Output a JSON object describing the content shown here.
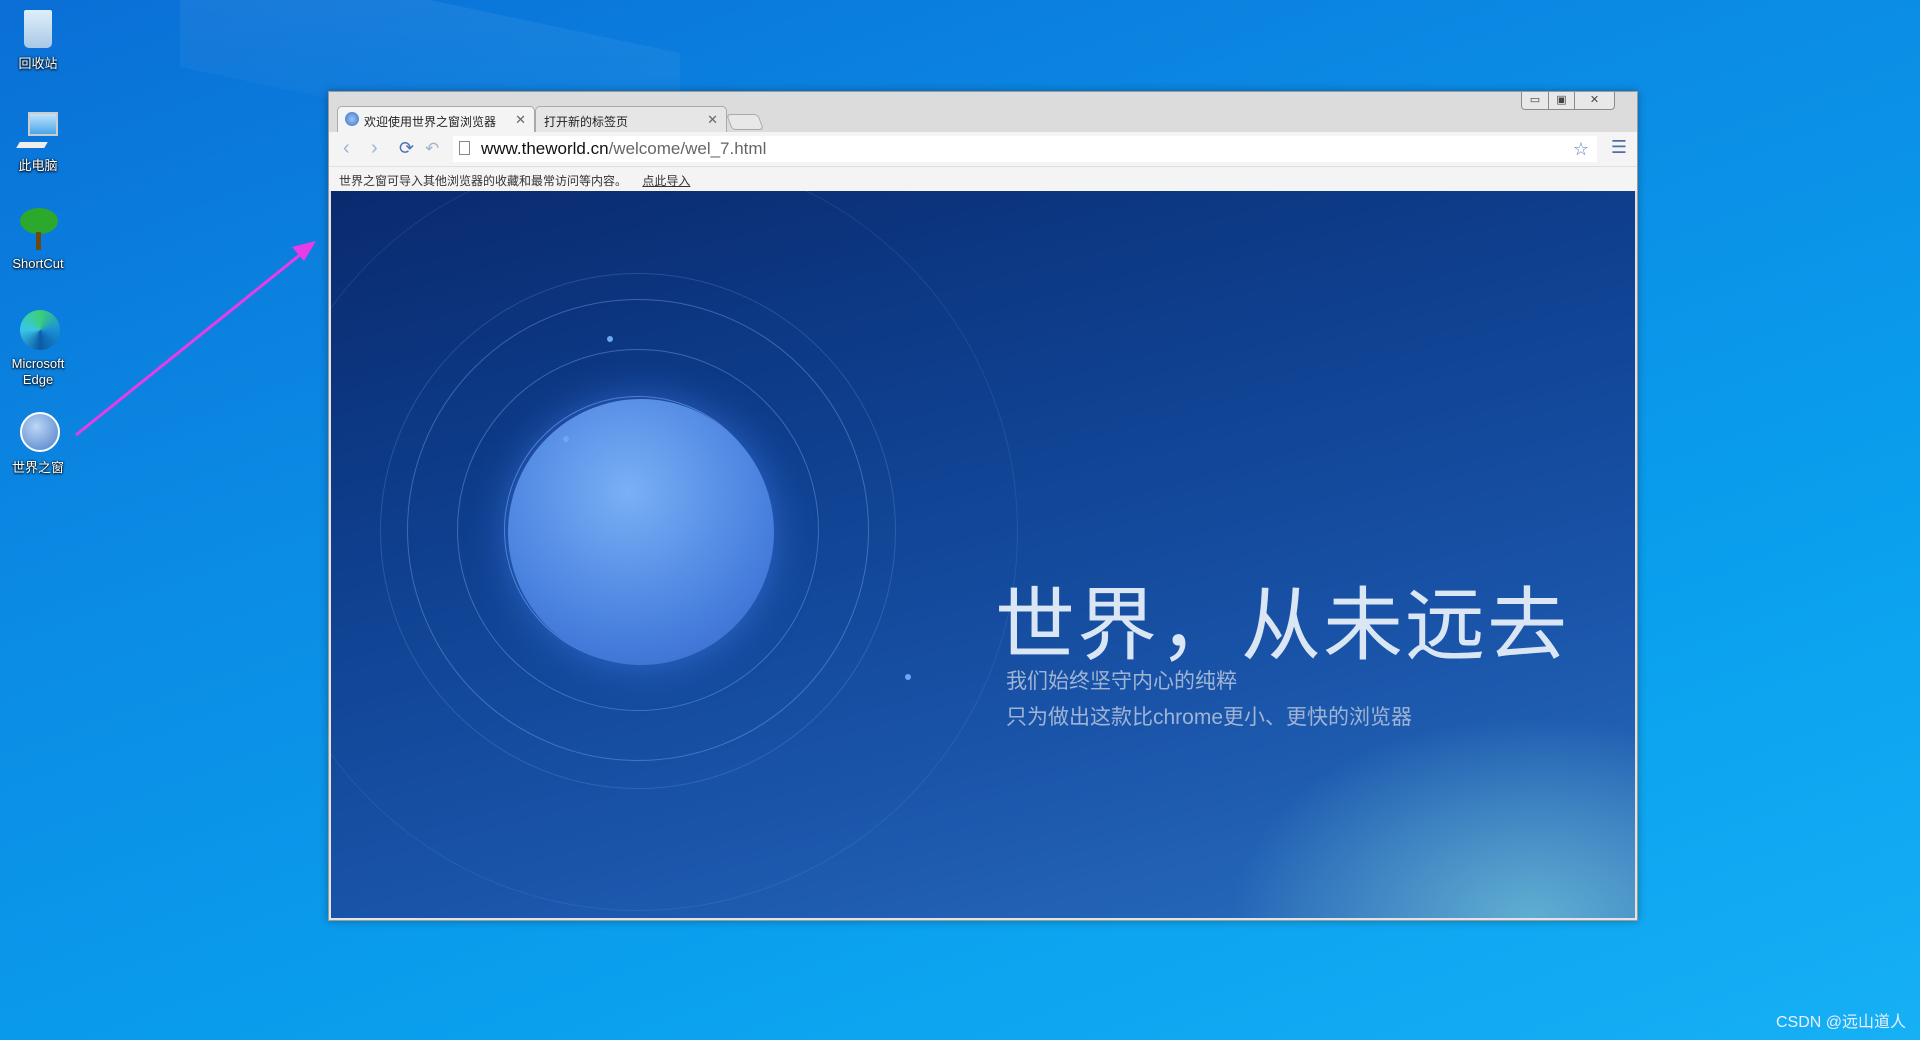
{
  "desktop": {
    "icons": [
      {
        "label": "回收站",
        "icon": "recycle-bin-icon"
      },
      {
        "label": "此电脑",
        "icon": "computer-icon"
      },
      {
        "label": "ShortCut",
        "icon": "tree-icon"
      },
      {
        "label": "Microsoft Edge",
        "icon": "edge-icon"
      },
      {
        "label": "世界之窗",
        "icon": "theworld-globe-icon"
      }
    ]
  },
  "browser": {
    "tabs": [
      {
        "label": "欢迎使用世界之窗浏览器",
        "active": true
      },
      {
        "label": "打开新的标签页",
        "active": false
      }
    ],
    "url_host": "www.theworld.cn",
    "url_path": "/welcome/wel_7.html",
    "infobar": {
      "text": "世界之窗可导入其他浏览器的收藏和最常访问等内容。",
      "link": "点此导入"
    },
    "page": {
      "title": "世界，从未远去",
      "line1": "我们始终坚守内心的纯粹",
      "line2": "只为做出这款比chrome更小、更快的浏览器"
    }
  },
  "annotation": {
    "arrow_color": "#e83ce8"
  },
  "watermark": "CSDN @远山道人"
}
